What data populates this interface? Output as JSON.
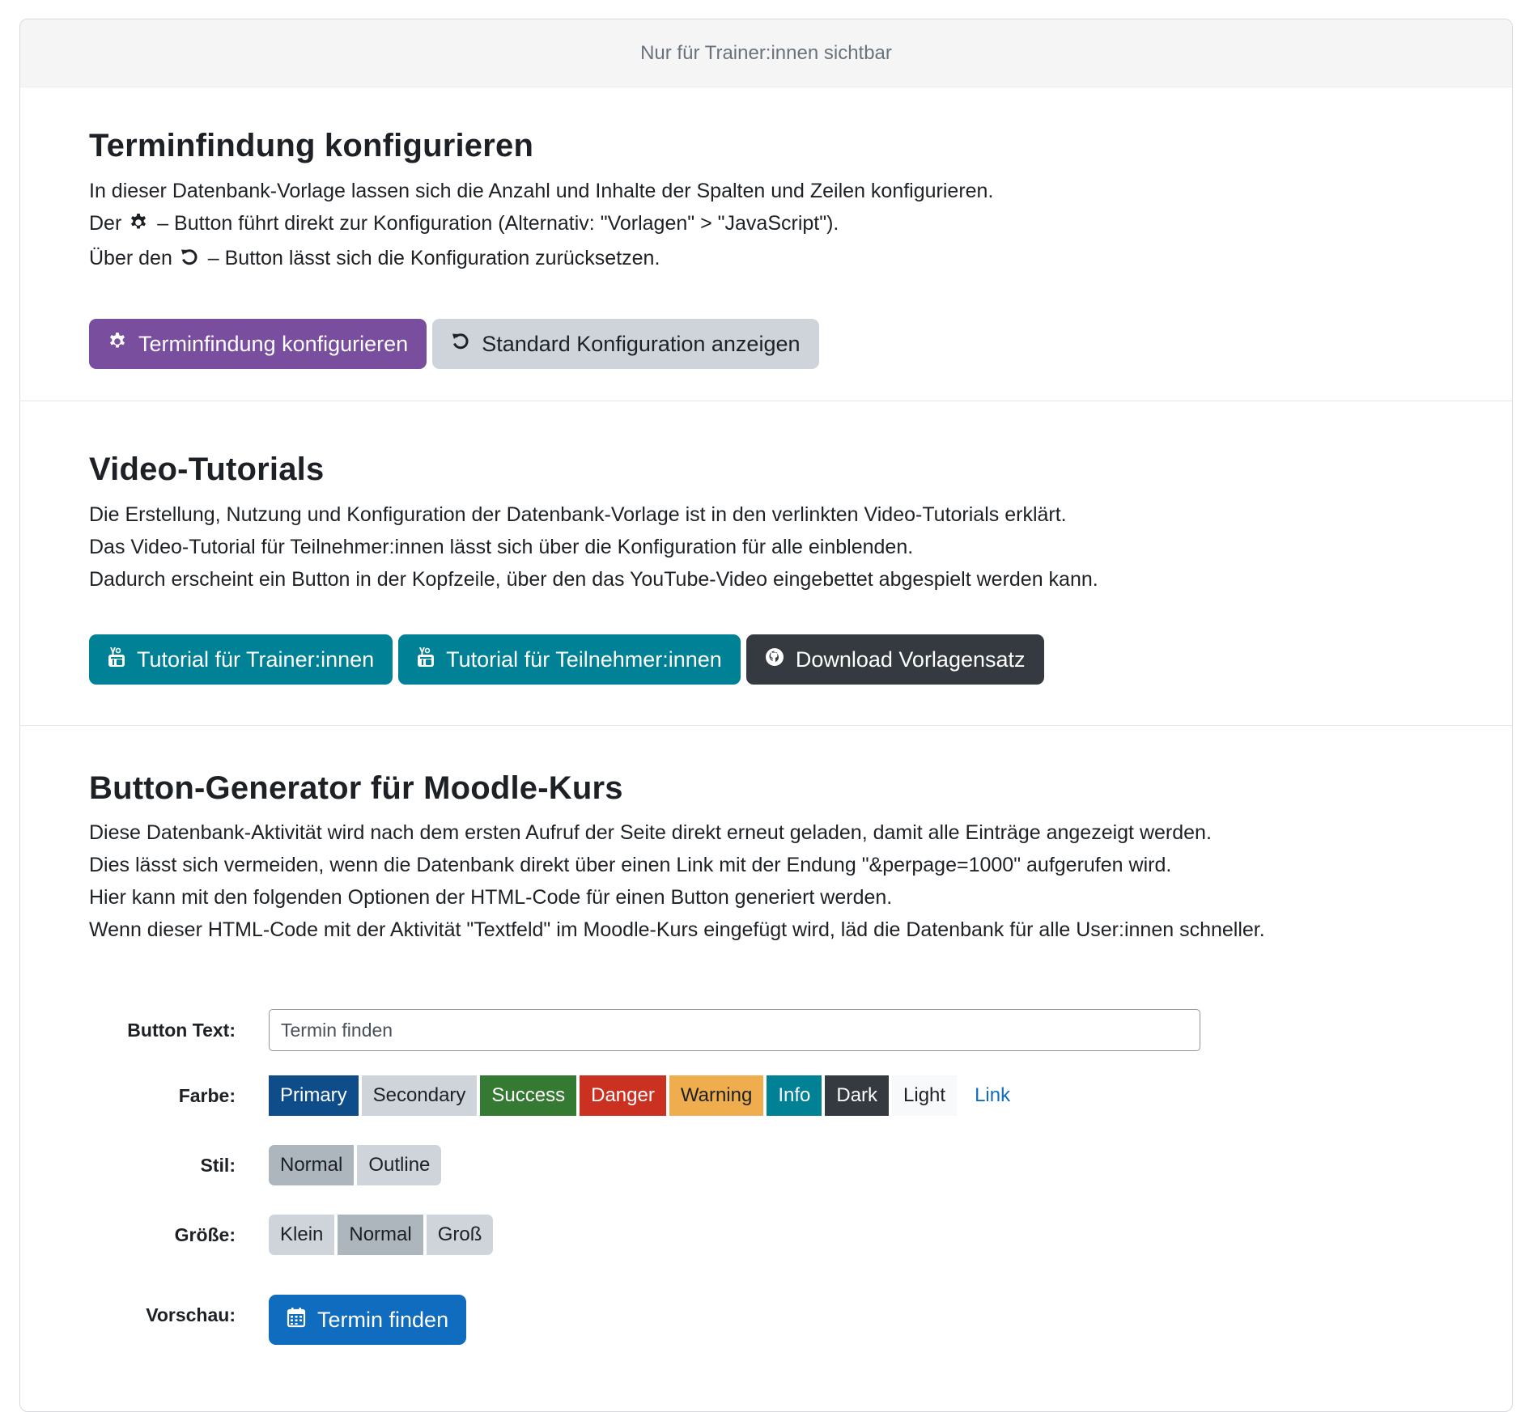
{
  "header": {
    "visibility_note": "Nur für Trainer:innen sichtbar"
  },
  "config": {
    "title": "Terminfindung konfigurieren",
    "line1": "In dieser Datenbank-Vorlage lassen sich die Anzahl und Inhalte der Spalten und Zeilen konfigurieren.",
    "line2_prefix": "Der",
    "line2_suffix": "– Button führt direkt zur Konfiguration (Alternativ: \"Vorlagen\" > \"JavaScript\").",
    "line3_prefix": "Über den",
    "line3_suffix": "– Button lässt sich die Konfiguration zurücksetzen.",
    "configure_button": "Terminfindung konfigurieren",
    "reset_button": "Standard Konfiguration anzeigen"
  },
  "tutorials": {
    "title": "Video-Tutorials",
    "line1": "Die Erstellung, Nutzung und Konfiguration der Datenbank-Vorlage ist in den verlinkten Video-Tutorials erklärt.",
    "line2": "Das Video-Tutorial für Teilnehmer:innen lässt sich über die Konfiguration für alle einblenden.",
    "line3": "Dadurch erscheint ein Button in der Kopfzeile, über den das YouTube-Video eingebettet abgespielt werden kann.",
    "trainer_button": "Tutorial für Trainer:innen",
    "participant_button": "Tutorial für Teilnehmer:innen",
    "download_button": "Download Vorlagensatz"
  },
  "generator": {
    "title": "Button-Generator für Moodle-Kurs",
    "line1": "Diese Datenbank-Aktivität wird nach dem ersten Aufruf der Seite direkt erneut geladen, damit alle Einträge angezeigt werden.",
    "line2": "Dies lässt sich vermeiden, wenn die Datenbank direkt über einen Link mit der Endung \"&perpage=1000\" aufgerufen wird.",
    "line3": "Hier kann mit den folgenden Optionen der HTML-Code für einen Button generiert werden.",
    "line4": "Wenn dieser HTML-Code mit der Aktivität \"Textfeld\" im Moodle-Kurs eingefügt wird, läd die Datenbank für alle User:innen schneller.",
    "text_label": "Button Text:",
    "text_value": "Termin finden",
    "color_label": "Farbe:",
    "colors": [
      {
        "label": "Primary",
        "bg": "#0f4c8a",
        "fg": "#ffffff"
      },
      {
        "label": "Secondary",
        "bg": "#ced4da",
        "fg": "#1d2125"
      },
      {
        "label": "Success",
        "bg": "#357a32",
        "fg": "#ffffff"
      },
      {
        "label": "Danger",
        "bg": "#ca3120",
        "fg": "#ffffff"
      },
      {
        "label": "Warning",
        "bg": "#f0ad4e",
        "fg": "#1d2125"
      },
      {
        "label": "Info",
        "bg": "#008196",
        "fg": "#ffffff"
      },
      {
        "label": "Dark",
        "bg": "#343a40",
        "fg": "#ffffff"
      },
      {
        "label": "Light",
        "bg": "#f8f9fa",
        "fg": "#1d2125"
      },
      {
        "label": "Link",
        "bg": "transparent",
        "fg": "#0f6cbf"
      }
    ],
    "selected_color": "Primary",
    "style_label": "Stil:",
    "styles": [
      "Normal",
      "Outline"
    ],
    "selected_style": "Normal",
    "size_label": "Größe:",
    "sizes": [
      "Klein",
      "Normal",
      "Groß"
    ],
    "selected_size": "Normal",
    "preview_label": "Vorschau:",
    "preview_button": "Termin finden"
  }
}
